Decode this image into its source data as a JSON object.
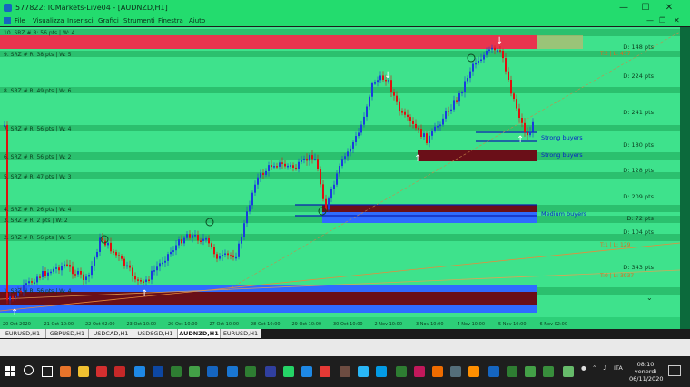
{
  "window": {
    "title": "577822: ICMarkets-Live04 - [AUDNZD,H1]"
  },
  "menu": [
    "File",
    "Visualizza",
    "Inserisci",
    "Grafici",
    "Strumenti",
    "Finestra",
    "Aiuto"
  ],
  "srz_labels": [
    "10. SRZ # R: 56 pts | W: 4",
    "9. SRZ # R: 38 pts | W: 5",
    "8. SRZ # R: 49 pts | W: 6",
    "7. SRZ # R: 56 pts | W: 4",
    "6. SRZ # R: 56 pts | W: 2",
    "5. SRZ # R: 47 pts | W: 3",
    "4. SRZ # R: 26 pts | W: 4",
    "3. SRZ # R: 2 pts | W: 2",
    "2. SRZ # R: 56 pts | W: 5",
    "1. SRZ # R: 56 pts | W: 4"
  ],
  "distances": [
    "D: 148 pts",
    "D: 224 pts",
    "D: 241 pts",
    "D: 180 pts",
    "D: 128 pts",
    "D: 209 pts",
    "D: 72 pts",
    "D: 104 pts",
    "D: 343 pts"
  ],
  "trend_labels": [
    "T:2 | L: 457",
    "T:1 | L: 129",
    "T:0 | L: 3937"
  ],
  "buyer_labels": [
    "Strong buyers",
    "Strong buyers",
    "Medium buyers"
  ],
  "time_axis": [
    "20 Oct 2020",
    "21 Oct 10:00",
    "22 Oct 02:00",
    "23 Oct 10:00",
    "26 Oct 10:00",
    "27 Oct 10:00",
    "28 Oct 10:00",
    "29 Oct 10:00",
    "30 Oct 10:00",
    "2 Nov 10:00",
    "3 Nov 10:00",
    "4 Nov 10:00",
    "5 Nov 10:00",
    "6 Nov 02:00"
  ],
  "tabs": [
    "EURUSD,H1",
    "GBPUSD,H1",
    "USDCAD,H1",
    "USDSGD,H1",
    "AUDNZD,H1",
    "EURUSD,H1"
  ],
  "active_tab": "AUDNZD,H1",
  "tray": {
    "lang": "ITA"
  },
  "clock": {
    "time": "08:10",
    "day": "venerdì",
    "date": "06/11/2020"
  },
  "colors": {
    "chart_bg": "#3ee28c",
    "bull": "#1a3cdc",
    "bear": "#e01010",
    "zone_red": "#e8344e",
    "zone_blue": "#2f6bff",
    "zone_dark": "#6a0f18"
  }
}
